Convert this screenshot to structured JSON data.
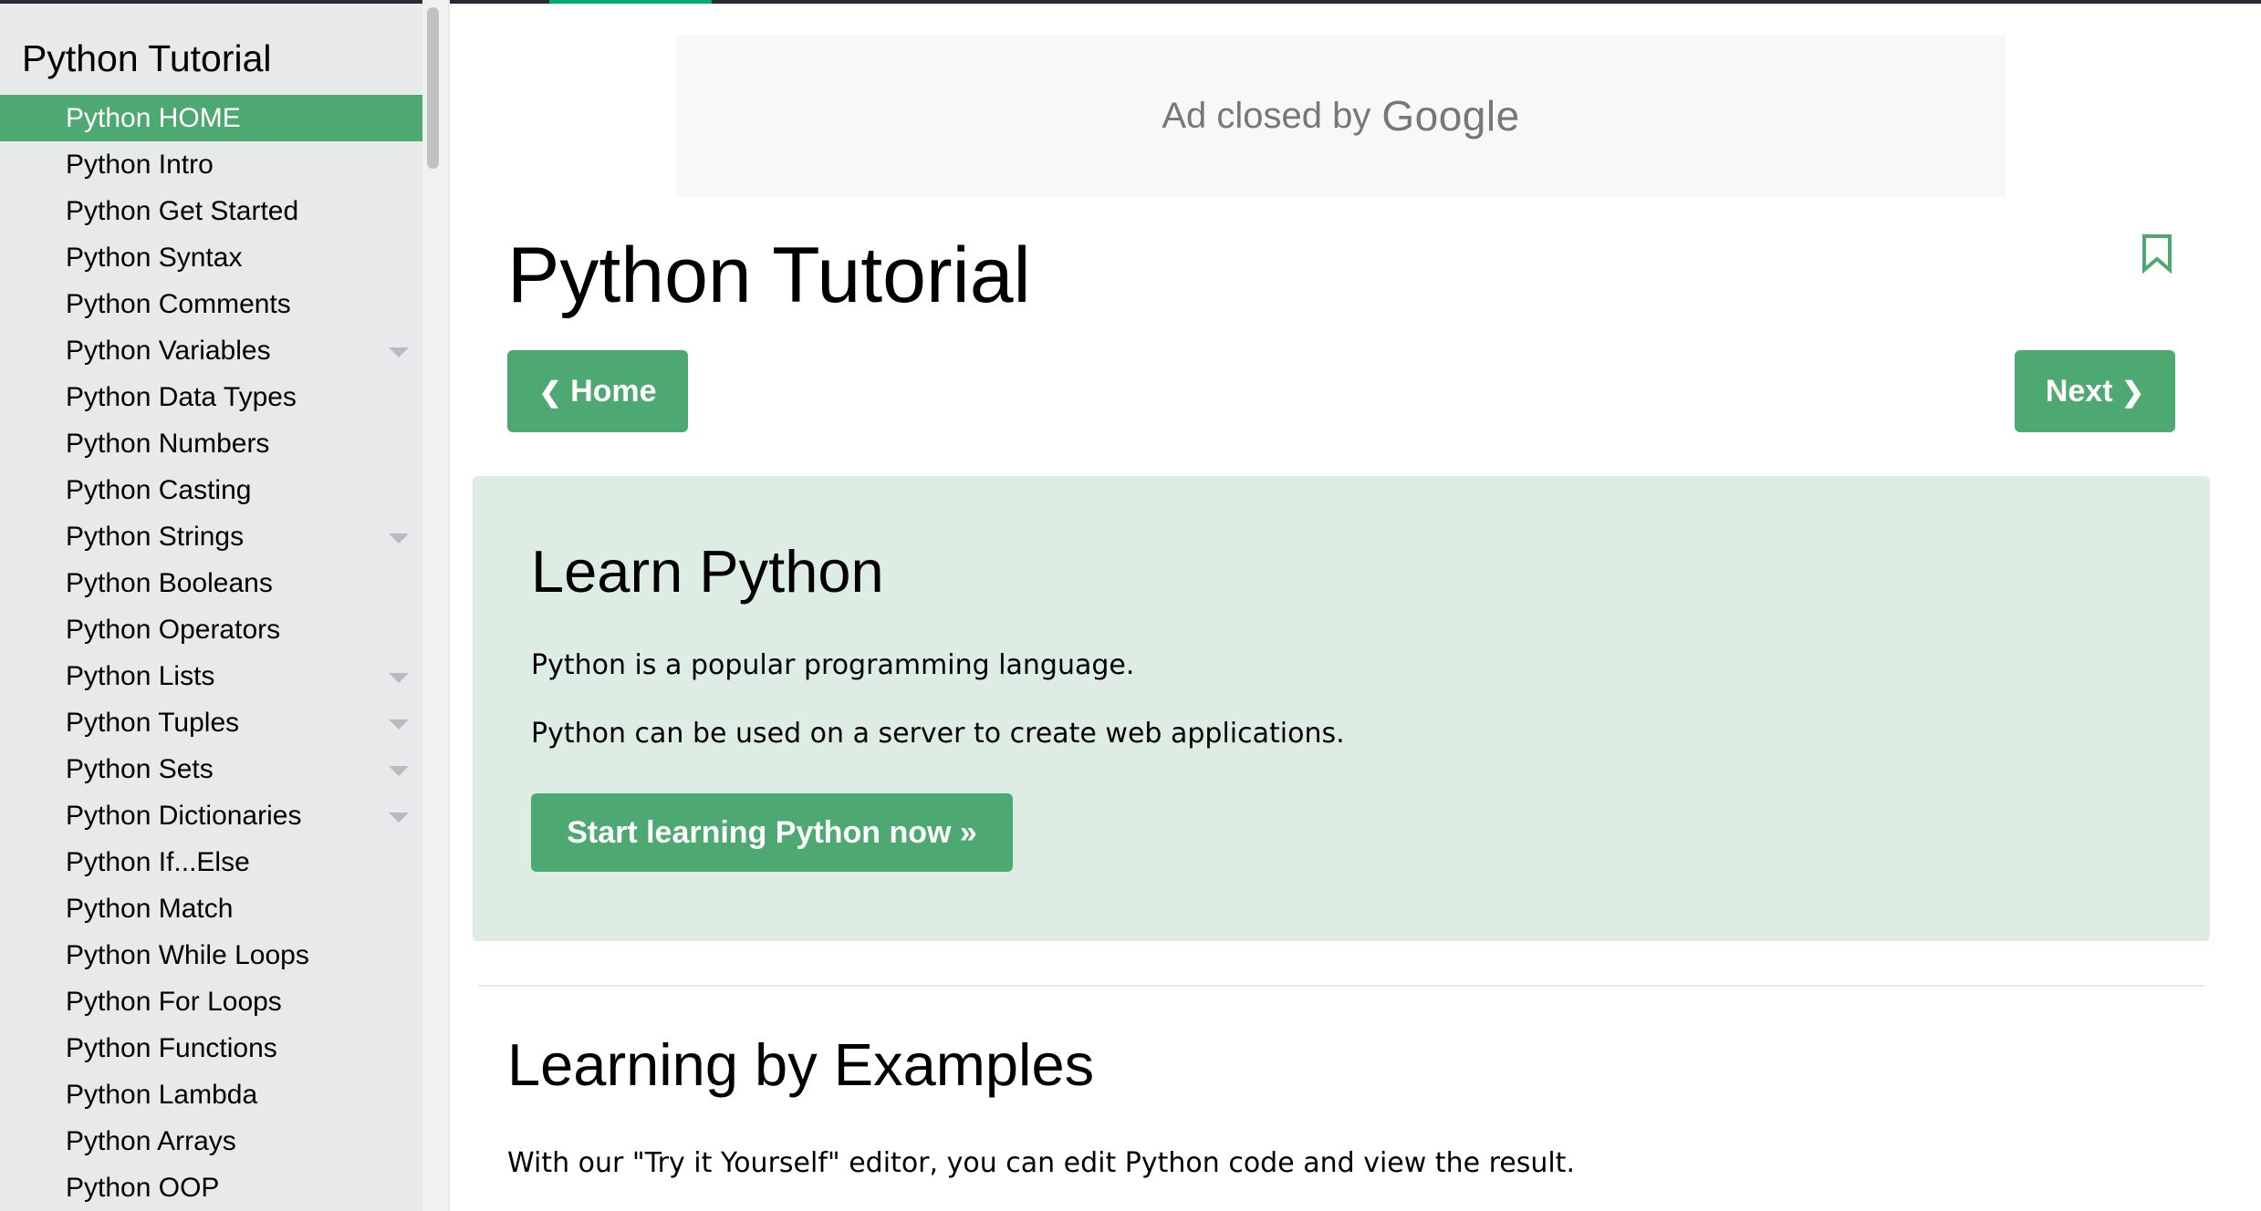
{
  "sidebar": {
    "title": "Python Tutorial",
    "items": [
      {
        "label": "Python HOME",
        "active": true,
        "expandable": false
      },
      {
        "label": "Python Intro",
        "expandable": false
      },
      {
        "label": "Python Get Started",
        "expandable": false
      },
      {
        "label": "Python Syntax",
        "expandable": false
      },
      {
        "label": "Python Comments",
        "expandable": false
      },
      {
        "label": "Python Variables",
        "expandable": true
      },
      {
        "label": "Python Data Types",
        "expandable": false
      },
      {
        "label": "Python Numbers",
        "expandable": false
      },
      {
        "label": "Python Casting",
        "expandable": false
      },
      {
        "label": "Python Strings",
        "expandable": true
      },
      {
        "label": "Python Booleans",
        "expandable": false
      },
      {
        "label": "Python Operators",
        "expandable": false
      },
      {
        "label": "Python Lists",
        "expandable": true
      },
      {
        "label": "Python Tuples",
        "expandable": true
      },
      {
        "label": "Python Sets",
        "expandable": true
      },
      {
        "label": "Python Dictionaries",
        "expandable": true
      },
      {
        "label": "Python If...Else",
        "expandable": false
      },
      {
        "label": "Python Match",
        "expandable": false
      },
      {
        "label": "Python While Loops",
        "expandable": false
      },
      {
        "label": "Python For Loops",
        "expandable": false
      },
      {
        "label": "Python Functions",
        "expandable": false
      },
      {
        "label": "Python Lambda",
        "expandable": false
      },
      {
        "label": "Python Arrays",
        "expandable": false
      },
      {
        "label": "Python OOP",
        "expandable": false
      }
    ]
  },
  "ad": {
    "text": "Ad closed by",
    "brand": "Google"
  },
  "main": {
    "title": "Python Tutorial",
    "bookmark_icon": "bookmark-icon",
    "home_button": "Home",
    "next_button": "Next",
    "prev_chevron": "❮",
    "next_chevron": "❯",
    "learn": {
      "title": "Learn Python",
      "p1": "Python is a popular programming language.",
      "p2": "Python can be used on a server to create web applications.",
      "button": "Start learning Python now »"
    },
    "examples": {
      "title": "Learning by Examples",
      "p": "With our \"Try it Yourself\" editor, you can edit Python code and view the result."
    }
  },
  "colors": {
    "accent": "#04aa6d",
    "button_green": "#4ea872",
    "sidebar_bg": "#e7e9eb",
    "learn_bg": "#ddede3"
  }
}
